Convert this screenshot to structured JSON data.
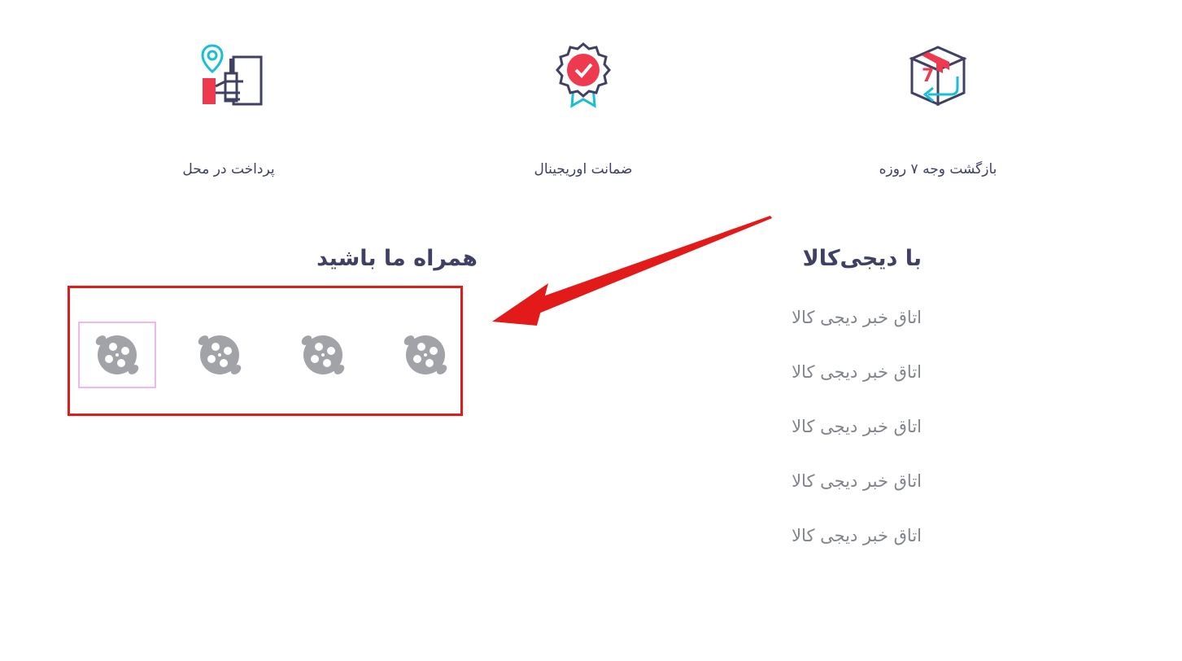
{
  "features": [
    {
      "label": "بازگشت وجه ۷ روزه",
      "icon": "return-box-icon"
    },
    {
      "label": "ضمانت اوریجینال",
      "icon": "original-badge-icon"
    },
    {
      "label": "پرداخت در محل",
      "icon": "pay-on-delivery-icon"
    }
  ],
  "with_digikala": {
    "title": "با دیجی‌کالا",
    "links": [
      "اتاق خبر دیجی کالا",
      "اتاق خبر دیجی کالا",
      "اتاق خبر دیجی کالا",
      "اتاق خبر دیجی کالا",
      "اتاق خبر دیجی کالا"
    ]
  },
  "follow_us": {
    "title": "همراه ما باشید",
    "icons": [
      "aparat-icon",
      "aparat-icon",
      "aparat-icon",
      "aparat-icon"
    ]
  },
  "box_icon_number": "7",
  "colors": {
    "text_dark": "#3f4064",
    "text_muted": "#81858b",
    "brand_red": "#ef394e",
    "teal": "#19bfd3",
    "annotation_red": "#e31a1a",
    "social_icon_gray": "#a1a3a8",
    "focus_outline": "#efb8ee"
  }
}
